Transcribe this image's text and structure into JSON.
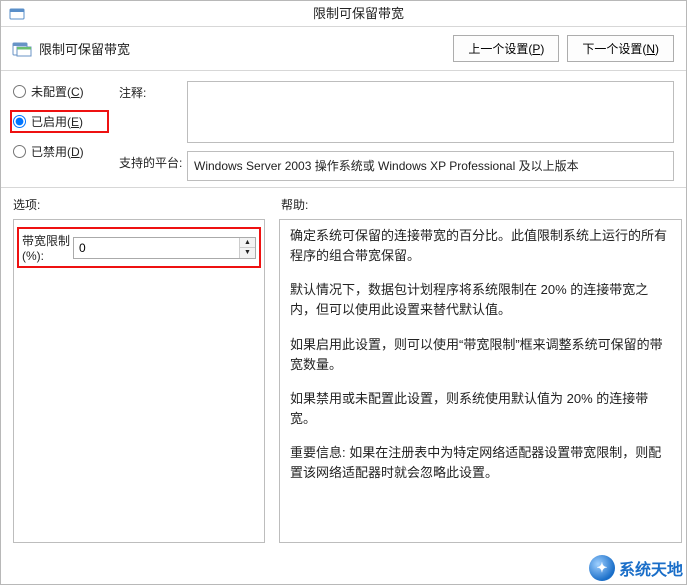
{
  "window": {
    "title": "限制可保留带宽"
  },
  "header": {
    "label": "限制可保留带宽",
    "prev_button": "上一个设置(P)",
    "next_button": "下一个设置(N)"
  },
  "radios": {
    "not_configured": "未配置(C)",
    "enabled": "已启用(E)",
    "disabled": "已禁用(D)",
    "selected": "enabled"
  },
  "fields": {
    "comment_label": "注释:",
    "comment_value": "",
    "platform_label": "支持的平台:",
    "platform_value": "Windows Server 2003 操作系统或 Windows XP Professional 及以上版本"
  },
  "columns": {
    "options_label": "选项:",
    "help_label": "帮助:"
  },
  "options": {
    "bandwidth_label": "带宽限制 (%):",
    "bandwidth_value": "0"
  },
  "help": {
    "p1": "确定系统可保留的连接带宽的百分比。此值限制系统上运行的所有程序的组合带宽保留。",
    "p2": "默认情况下，数据包计划程序将系统限制在 20% 的连接带宽之内，但可以使用此设置来替代默认值。",
    "p3": "如果启用此设置，则可以使用“带宽限制”框来调整系统可保留的带宽数量。",
    "p4": "如果禁用或未配置此设置，则系统使用默认值为 20% 的连接带宽。",
    "p5": "重要信息: 如果在注册表中为特定网络适配器设置带宽限制，则配置该网络适配器时就会忽略此设置。"
  },
  "watermark": {
    "text": "系统天地"
  }
}
